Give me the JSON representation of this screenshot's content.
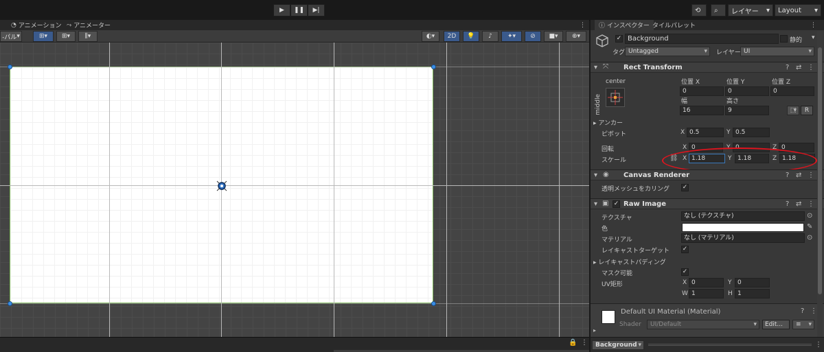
{
  "toolbar": {
    "layers_label": "レイヤー",
    "layout_label": "Layout",
    "play_icon": "play-icon",
    "pause_icon": "pause-icon",
    "step_icon": "step-icon"
  },
  "left_tabs": {
    "animation": "アニメーション",
    "animator": "アニメーター",
    "palette_partial": "-パル"
  },
  "scene_toolbar": {
    "mode_2d": "2D"
  },
  "inspector": {
    "tabs": {
      "inspector": "インスペクター",
      "tile_palette": "タイルパレット"
    },
    "object": {
      "name": "Background",
      "static_label": "静的",
      "tag_label": "タグ",
      "tag_value": "Untagged",
      "layer_label": "レイヤー",
      "layer_value": "UI"
    },
    "rect_transform": {
      "title": "Rect Transform",
      "anchor_h": "center",
      "anchor_v": "middle",
      "pos_x_label": "位置 X",
      "pos_y_label": "位置 Y",
      "pos_z_label": "位置 Z",
      "pos_x": "0",
      "pos_y": "0",
      "pos_z": "0",
      "width_label": "幅",
      "height_label": "高さ",
      "width": "16",
      "height": "9",
      "r_button": "R",
      "anchors_label": "アンカー",
      "pivot_label": "ピボット",
      "pivot_x": "0.5",
      "pivot_y": "0.5",
      "rotation_label": "回転",
      "rot_x": "0",
      "rot_y": "0",
      "rot_z": "0",
      "scale_label": "スケール",
      "scale_x": "1.18",
      "scale_y": "1.18",
      "scale_z": "1.18",
      "x": "X",
      "y": "Y",
      "z": "Z"
    },
    "canvas_renderer": {
      "title": "Canvas Renderer",
      "cull_label": "透明メッシュをカリング"
    },
    "raw_image": {
      "title": "Raw Image",
      "texture_label": "テクスチャ",
      "texture_value": "なし (テクスチャ)",
      "color_label": "色",
      "color_value": "#ffffff",
      "material_label": "マテリアル",
      "material_value": "なし (マテリアル)",
      "raycast_target_label": "レイキャストターゲット",
      "raycast_padding_label": "レイキャストパディング",
      "maskable_label": "マスク可能",
      "uv_rect_label": "UV矩形",
      "uv_x": "0",
      "uv_y": "0",
      "uv_w": "1",
      "uv_h": "1",
      "w": "W",
      "h": "H"
    },
    "material": {
      "title": "Default UI Material (Material)",
      "shader_label": "Shader",
      "shader_value": "UI/Default",
      "edit_button": "Edit..."
    },
    "footer_object": "Background"
  }
}
